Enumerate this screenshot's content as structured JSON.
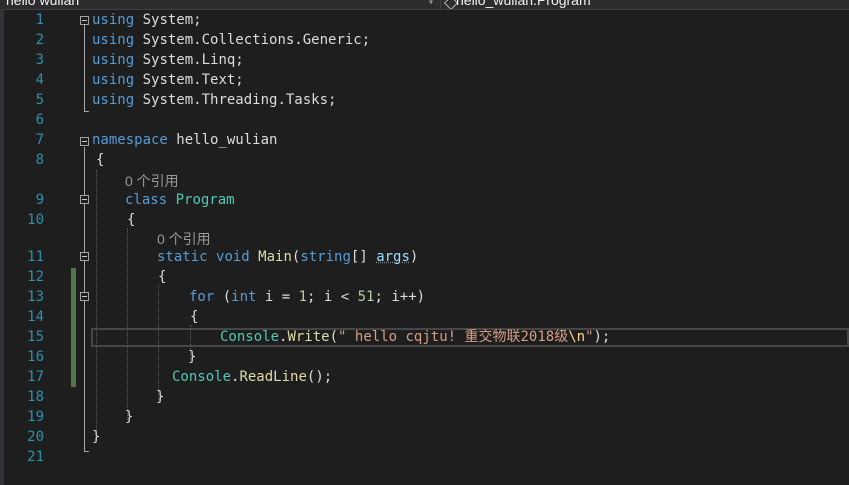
{
  "navigation": {
    "left_dropdown": "hello wulian",
    "right_dropdown": "hello_wulian.Program"
  },
  "code_lens": {
    "program_refs": "0 个引用",
    "main_refs": "0 个引用"
  },
  "lines": [
    {
      "n": "1",
      "tokens": [
        {
          "c": "kw",
          "t": "using"
        },
        {
          "c": "pl",
          "t": " System;"
        }
      ]
    },
    {
      "n": "2",
      "tokens": [
        {
          "c": "kw",
          "t": "using"
        },
        {
          "c": "pl",
          "t": " System.Collections.Generic;"
        }
      ]
    },
    {
      "n": "3",
      "tokens": [
        {
          "c": "kw",
          "t": "using"
        },
        {
          "c": "pl",
          "t": " System.Linq;"
        }
      ]
    },
    {
      "n": "4",
      "tokens": [
        {
          "c": "kw",
          "t": "using"
        },
        {
          "c": "pl",
          "t": " System.Text;"
        }
      ]
    },
    {
      "n": "5",
      "tokens": [
        {
          "c": "kw",
          "t": "using"
        },
        {
          "c": "pl",
          "t": " System.Threading.Tasks;"
        }
      ]
    },
    {
      "n": "6",
      "tokens": []
    },
    {
      "n": "7",
      "tokens": [
        {
          "c": "kw",
          "t": "namespace"
        },
        {
          "c": "pl",
          "t": " hello_wulian"
        }
      ]
    },
    {
      "n": "8",
      "tokens": [
        {
          "c": "pl",
          "t": "{"
        }
      ]
    },
    {
      "n": "9",
      "tokens": [
        {
          "c": "kw",
          "t": "class"
        },
        {
          "c": "pl",
          "t": " "
        },
        {
          "c": "ty",
          "t": "Program"
        }
      ]
    },
    {
      "n": "10",
      "tokens": [
        {
          "c": "pl",
          "t": "{"
        }
      ]
    },
    {
      "n": "11",
      "tokens": [
        {
          "c": "kw",
          "t": "static"
        },
        {
          "c": "pl",
          "t": " "
        },
        {
          "c": "kw",
          "t": "void"
        },
        {
          "c": "pl",
          "t": " "
        },
        {
          "c": "mt",
          "t": "Main"
        },
        {
          "c": "pl",
          "t": "("
        },
        {
          "c": "kw",
          "t": "string"
        },
        {
          "c": "pl",
          "t": "[] "
        },
        {
          "c": "param",
          "t": "args"
        },
        {
          "c": "pl",
          "t": ")"
        }
      ]
    },
    {
      "n": "12",
      "tokens": [
        {
          "c": "pl",
          "t": "{"
        }
      ]
    },
    {
      "n": "13",
      "tokens": [
        {
          "c": "kw",
          "t": "for"
        },
        {
          "c": "pl",
          "t": " ("
        },
        {
          "c": "kw",
          "t": "int"
        },
        {
          "c": "pl",
          "t": " i = "
        },
        {
          "c": "num",
          "t": "1"
        },
        {
          "c": "pl",
          "t": "; i < "
        },
        {
          "c": "num",
          "t": "51"
        },
        {
          "c": "pl",
          "t": "; i++)"
        }
      ]
    },
    {
      "n": "14",
      "tokens": [
        {
          "c": "pl",
          "t": "{"
        }
      ]
    },
    {
      "n": "15",
      "tokens": [
        {
          "c": "ty",
          "t": "Console"
        },
        {
          "c": "pl",
          "t": "."
        },
        {
          "c": "mt",
          "t": "Write"
        },
        {
          "c": "pl",
          "t": "("
        },
        {
          "c": "str",
          "t": "\" hello cqjtu! 重交物联2018级"
        },
        {
          "c": "esc",
          "t": "\\n"
        },
        {
          "c": "str",
          "t": "\""
        },
        {
          "c": "pl",
          "t": ");"
        }
      ]
    },
    {
      "n": "16",
      "tokens": [
        {
          "c": "pl",
          "t": "}"
        }
      ]
    },
    {
      "n": "17",
      "tokens": [
        {
          "c": "ty",
          "t": "Console"
        },
        {
          "c": "pl",
          "t": "."
        },
        {
          "c": "mt",
          "t": "ReadLine"
        },
        {
          "c": "pl",
          "t": "();"
        }
      ]
    },
    {
      "n": "18",
      "tokens": [
        {
          "c": "pl",
          "t": "}"
        }
      ]
    },
    {
      "n": "19",
      "tokens": [
        {
          "c": "pl",
          "t": "}"
        }
      ]
    },
    {
      "n": "20",
      "tokens": [
        {
          "c": "pl",
          "t": "}"
        }
      ]
    },
    {
      "n": "21",
      "tokens": []
    }
  ]
}
